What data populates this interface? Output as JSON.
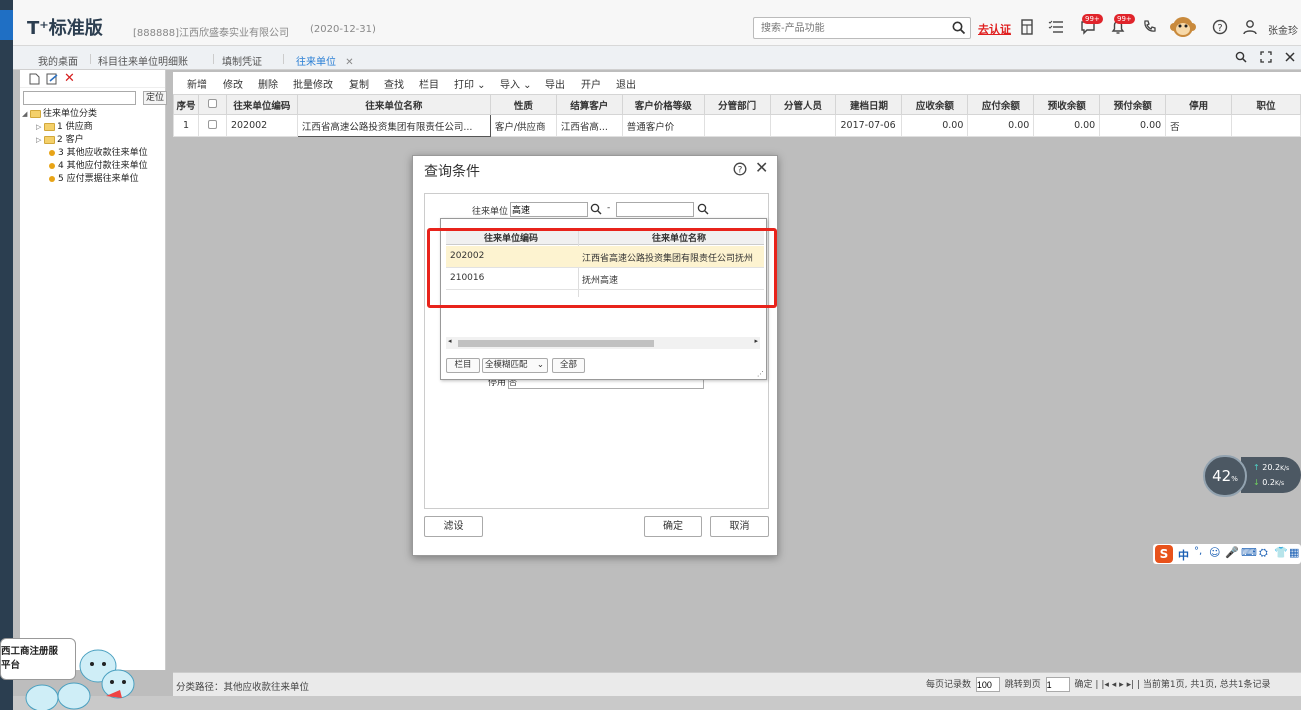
{
  "app": {
    "brand": "T⁺标准版",
    "company": "[888888]江西欣盛泰实业有限公司",
    "date": "(2020-12-31)",
    "search_placeholder": "搜索-产品功能",
    "certify": "去认证",
    "badge1": "99+",
    "badge2": "99+",
    "user": "张金珍"
  },
  "tabs": [
    {
      "label": "我的桌面"
    },
    {
      "label": "科目往来单位明细账"
    },
    {
      "label": "填制凭证"
    },
    {
      "label": "往来单位",
      "active": true
    }
  ],
  "tree": {
    "locate": "定位",
    "root": "往来单位分类",
    "nodes": [
      "1 供应商",
      "2 客户",
      "3 其他应收款往来单位",
      "4 其他应付款往来单位",
      "5 应付票据往来单位"
    ]
  },
  "toolbar": {
    "items": [
      "新增",
      "修改",
      "删除",
      "批量修改",
      "复制",
      "查找",
      "栏目",
      "打印",
      "导入",
      "导出",
      "开户",
      "退出"
    ]
  },
  "grid": {
    "columns": [
      "序号",
      "",
      "往来单位编码",
      "往来单位名称",
      "性质",
      "结算客户",
      "客户价格等级",
      "分管部门",
      "分管人员",
      "建档日期",
      "应收余额",
      "应付余额",
      "预收余额",
      "预付余额",
      "停用",
      "职位"
    ],
    "rows": [
      [
        "1",
        "",
        "202002",
        "江西省高速公路投资集团有限责任公司...",
        "客户/供应商",
        "江西省高...",
        "普通客户价",
        "",
        "",
        "2017-07-06",
        "0.00",
        "0.00",
        "0.00",
        "0.00",
        "否",
        ""
      ]
    ]
  },
  "status": {
    "path": "分类路径：其他应收款往来单位",
    "per_page_label": "每页记录数",
    "per_page": "100",
    "jump_label": "跳转到页",
    "jump_page": "1",
    "confirm": "确定",
    "summary": "当前第1页, 共1页, 总共1条记录"
  },
  "dialog": {
    "title": "查询条件",
    "field_label": "往来单位",
    "field_value": "高速",
    "dash": "-",
    "hidden_label": "停用",
    "hidden_value": "否",
    "filter_btn": "滤设",
    "ok_btn": "确定",
    "cancel_btn": "取消"
  },
  "dropdown": {
    "headers": [
      "往来单位编码",
      "往来单位名称"
    ],
    "rows": [
      {
        "code": "202002",
        "name": "江西省高速公路投资集团有限责任公司抚州",
        "selected": true
      },
      {
        "code": "210016",
        "name": "抚州高速",
        "selected": false
      }
    ],
    "btn_columns": "栏目",
    "match_mode": "全模糊匹配",
    "btn_all": "全部"
  },
  "mascot": {
    "line1": "西工商注册服",
    "line2": "平台"
  },
  "network": {
    "percent": "42",
    "unit": "%",
    "up": "20.2",
    "down": "0.2",
    "speed_unit": "K/s"
  },
  "ime": {
    "label": "中"
  },
  "colors": {
    "accent": "#2a7fd5",
    "highlight": "#e8231b",
    "selected_row": "#fdf3d0"
  }
}
